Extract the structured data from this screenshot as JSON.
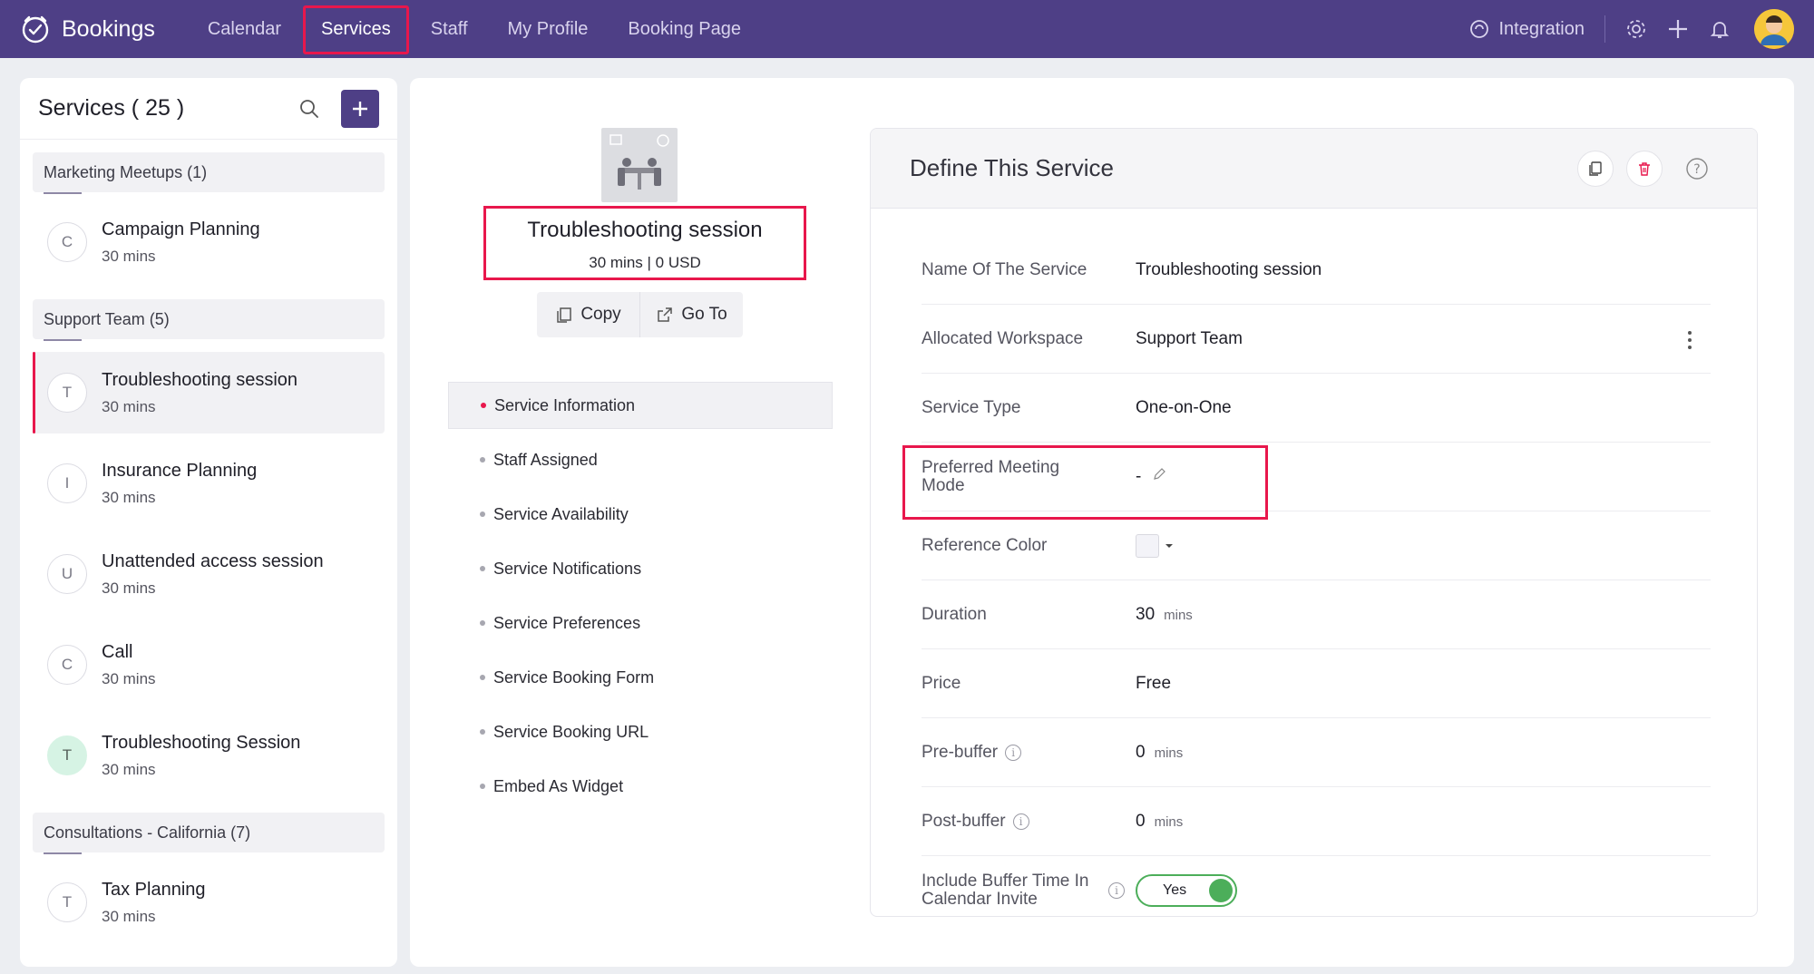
{
  "app": {
    "name": "Bookings"
  },
  "nav": {
    "items": [
      {
        "label": "Calendar",
        "active": false
      },
      {
        "label": "Services",
        "active": true
      },
      {
        "label": "Staff",
        "active": false
      },
      {
        "label": "My Profile",
        "active": false
      },
      {
        "label": "Booking Page",
        "active": false
      }
    ],
    "integration": "Integration"
  },
  "sidebar": {
    "title": "Services ( 25 )",
    "groups": [
      {
        "name": "Marketing Meetups (1)"
      },
      {
        "name": "Support Team (5)"
      },
      {
        "name": "Consultations - California (7)"
      }
    ],
    "services": [
      {
        "initial": "C",
        "name": "Campaign Planning",
        "duration": "30 mins"
      },
      {
        "initial": "T",
        "name": "Troubleshooting session",
        "duration": "30 mins"
      },
      {
        "initial": "I",
        "name": "Insurance Planning",
        "duration": "30 mins"
      },
      {
        "initial": "U",
        "name": "Unattended access session",
        "duration": "30 mins"
      },
      {
        "initial": "C",
        "name": "Call",
        "duration": "30 mins"
      },
      {
        "initial": "T",
        "name": "Troubleshooting Session",
        "duration": "30 mins"
      },
      {
        "initial": "T",
        "name": "Tax Planning",
        "duration": "30 mins"
      }
    ]
  },
  "service": {
    "title": "Troubleshooting session",
    "subtitle": "30 mins | 0 USD",
    "copy_label": "Copy",
    "goto_label": "Go To"
  },
  "menu": {
    "items": [
      "Service Information",
      "Staff Assigned",
      "Service Availability",
      "Service Notifications",
      "Service Preferences",
      "Service Booking Form",
      "Service Booking URL",
      "Embed As Widget"
    ]
  },
  "define": {
    "title": "Define This Service",
    "fields": {
      "name": {
        "label": "Name Of The Service",
        "value": "Troubleshooting session"
      },
      "workspace": {
        "label": "Allocated Workspace",
        "value": "Support Team"
      },
      "type": {
        "label": "Service Type",
        "value": "One-on-One"
      },
      "meeting_mode": {
        "label": "Preferred Meeting Mode",
        "value": "-"
      },
      "color": {
        "label": "Reference Color"
      },
      "duration": {
        "label": "Duration",
        "value": "30",
        "unit": "mins"
      },
      "price": {
        "label": "Price",
        "value": "Free"
      },
      "prebuffer": {
        "label": "Pre-buffer",
        "value": "0",
        "unit": "mins"
      },
      "postbuffer": {
        "label": "Post-buffer",
        "value": "0",
        "unit": "mins"
      },
      "include_buffer": {
        "label": "Include Buffer Time In Calendar Invite",
        "value": "Yes"
      }
    }
  },
  "colors": {
    "header": "#4e3f86",
    "highlight": "#e8174c",
    "toggle_on": "#4cae5a"
  }
}
